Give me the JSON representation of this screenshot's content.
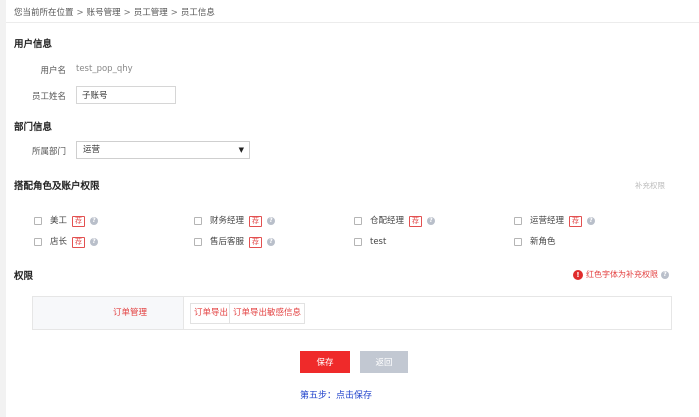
{
  "breadcrumb": {
    "prefix": "您当前所在位置",
    "sep": ">",
    "items": [
      "账号管理",
      "员工管理",
      "员工信息"
    ]
  },
  "user_info": {
    "title": "用户信息",
    "username_label": "用户名",
    "username_value": "test_pop_qhy",
    "staff_name_label": "员工姓名",
    "staff_name_value": "子账号"
  },
  "department": {
    "title": "部门信息",
    "label": "所属部门",
    "selected": "运营"
  },
  "roles": {
    "title": "搭配角色及账户权限",
    "supplement_link": "补充权限",
    "tag_text": "荐",
    "help_text": "?",
    "items": [
      {
        "label": "美工"
      },
      {
        "label": "财务经理"
      },
      {
        "label": "仓配经理"
      },
      {
        "label": "运营经理"
      },
      {
        "label": "店长"
      },
      {
        "label": "售后客服"
      },
      {
        "label": "test"
      },
      {
        "label": "新角色"
      }
    ]
  },
  "permissions": {
    "title": "权限",
    "legend_icon": "!",
    "legend_text": "红色字体为补充权限",
    "module": "订单管理",
    "items": [
      "订单导出",
      "订单导出敏感信息"
    ]
  },
  "actions": {
    "save": "保存",
    "back": "返回",
    "hint": "第五步：点击保存"
  },
  "colors": {
    "accent_red": "#ef2a2a",
    "hint_blue": "#2244cc",
    "disabled_grey": "#c2c8d2"
  }
}
